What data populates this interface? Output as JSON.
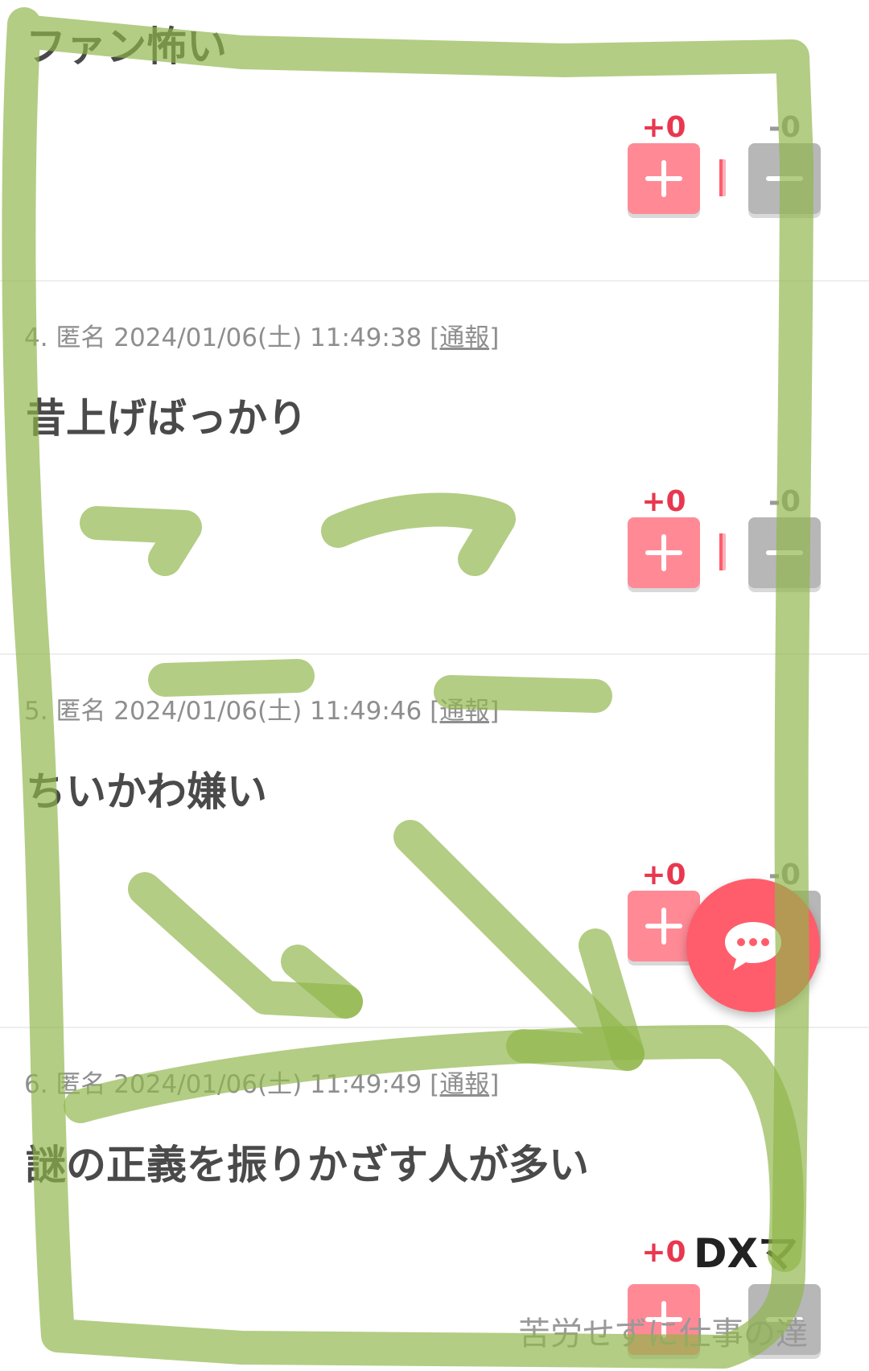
{
  "comments": [
    {
      "body": "ファン怖い",
      "votes": {
        "plus": "+0",
        "minus": "-0"
      }
    },
    {
      "number": "4.",
      "author": "匿名",
      "datetime": "2024/01/06(土) 11:49:38",
      "report": "[通報]",
      "body": "昔上げばっかり",
      "votes": {
        "plus": "+0",
        "minus": "-0"
      }
    },
    {
      "number": "5.",
      "author": "匿名",
      "datetime": "2024/01/06(土) 11:49:46",
      "report": "[通報]",
      "body": "ちいかわ嫌い",
      "votes": {
        "plus": "+0",
        "minus": "-0"
      }
    },
    {
      "number": "6.",
      "author": "匿名",
      "datetime": "2024/01/06(土) 11:49:49",
      "report": "[通報]",
      "body": "謎の正義を振りかざす人が多い",
      "votes": {
        "plus": "+0"
      }
    }
  ],
  "ad": {
    "title": "DXマ",
    "subtitle": "苦労せずに仕事の達"
  },
  "icons": {
    "plus": "plus-icon",
    "minus": "minus-icon",
    "chat": "chat-bubble-icon"
  },
  "colors": {
    "plus_accent": "#e8384f",
    "plus_button": "#ff8a96",
    "minus_button": "#b7b7b7",
    "fab": "#ff5d6b",
    "scribble": "#8fb64a"
  }
}
